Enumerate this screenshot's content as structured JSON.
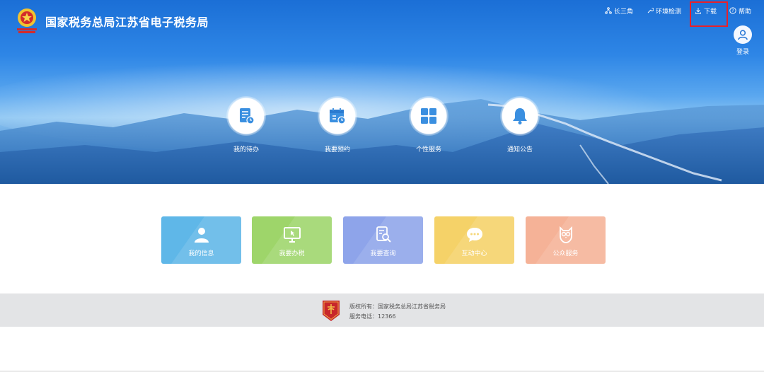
{
  "header": {
    "title": "国家税务总局江苏省电子税务局",
    "nav": [
      {
        "label": "长三角",
        "icon": "network-icon"
      },
      {
        "label": "环境检测",
        "icon": "wrench-icon"
      },
      {
        "label": "下载",
        "icon": "download-icon"
      },
      {
        "label": "帮助",
        "icon": "help-icon"
      }
    ],
    "login_label": "登录"
  },
  "quick_entries": [
    {
      "label": "我的待办",
      "icon": "todo-list-icon"
    },
    {
      "label": "我要预约",
      "icon": "calendar-icon"
    },
    {
      "label": "个性服务",
      "icon": "grid-icon"
    },
    {
      "label": "通知公告",
      "icon": "bell-icon"
    }
  ],
  "cards": [
    {
      "label": "我的信息",
      "icon": "user-icon",
      "color": "#5fb7e8"
    },
    {
      "label": "我要办税",
      "icon": "monitor-icon",
      "color": "#9ed56a"
    },
    {
      "label": "我要查询",
      "icon": "search-doc-icon",
      "color": "#8ea4ea"
    },
    {
      "label": "互动中心",
      "icon": "chat-icon",
      "color": "#f5d268"
    },
    {
      "label": "公众服务",
      "icon": "owl-icon",
      "color": "#f5b297"
    }
  ],
  "footer": {
    "copyright": "版权所有：国家税务总局江苏省税务局",
    "phone": "服务电话：12366"
  },
  "colors": {
    "accent_highlight": "#e8202a",
    "footer_bg": "#e3e4e6",
    "header_blue": "#1b6fd6"
  }
}
